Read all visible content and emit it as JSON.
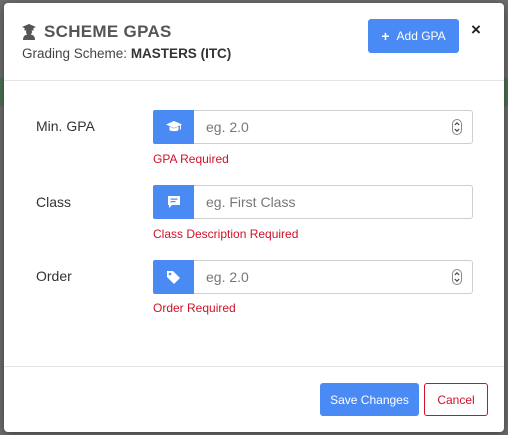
{
  "modal": {
    "title": "SCHEME GPAS",
    "subtitle_prefix": "Grading Scheme: ",
    "subtitle_value": "MASTERS (ITC)",
    "add_button_label": "Add GPA",
    "close_label": "×"
  },
  "fields": [
    {
      "label": "Min. GPA",
      "placeholder": "eg. 2.0",
      "value": "",
      "icon": "graduation-cap-icon",
      "error": "GPA Required",
      "type": "number"
    },
    {
      "label": "Class",
      "placeholder": "eg. First Class",
      "value": "",
      "icon": "comment-icon",
      "error": "Class Description Required",
      "type": "text"
    },
    {
      "label": "Order",
      "placeholder": "eg. 2.0",
      "value": "",
      "icon": "tag-icon",
      "error": "Order Required",
      "type": "number"
    }
  ],
  "footer": {
    "save_label": "Save Changes",
    "cancel_label": "Cancel"
  },
  "colors": {
    "primary": "#4a8af4",
    "danger": "#d0112b",
    "title_text": "#555555"
  }
}
